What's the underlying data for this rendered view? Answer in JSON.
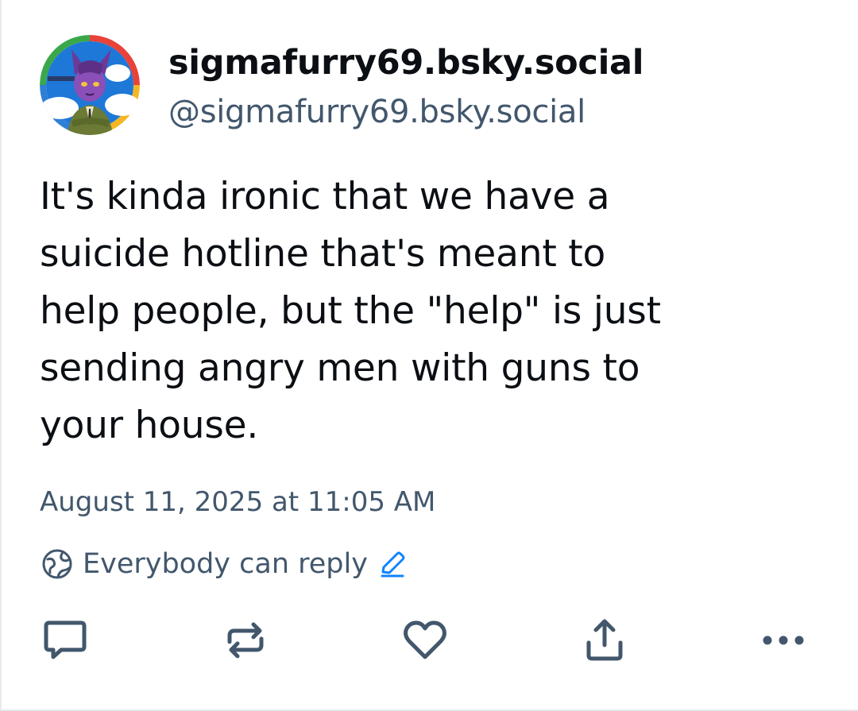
{
  "post": {
    "author": {
      "display_name": "sigmafurry69.bsky.social",
      "handle": "@sigmafurry69.bsky.social",
      "avatar_icon": "avatar-image"
    },
    "text": "It's kinda ironic that we have a\nsuicide hotline that's meant to\nhelp people, but the \"help\" is just\nsending angry men with guns to\nyour house.",
    "timestamp": "August 11, 2025 at 11:05 AM",
    "reply_settings": {
      "label": "Everybody can reply",
      "icon": "globe-icon",
      "edit_icon": "pencil-icon"
    },
    "actions": [
      {
        "name": "reply",
        "icon": "speech-bubble-icon"
      },
      {
        "name": "repost",
        "icon": "repost-arrows-icon"
      },
      {
        "name": "like",
        "icon": "heart-icon"
      },
      {
        "name": "share",
        "icon": "share-upload-icon"
      },
      {
        "name": "more",
        "icon": "ellipsis-icon"
      }
    ]
  },
  "colors": {
    "primary_text": "#0b0f14",
    "secondary_text": "#42576c",
    "accent": "#1083fe",
    "divider": "#e6e9ee"
  }
}
